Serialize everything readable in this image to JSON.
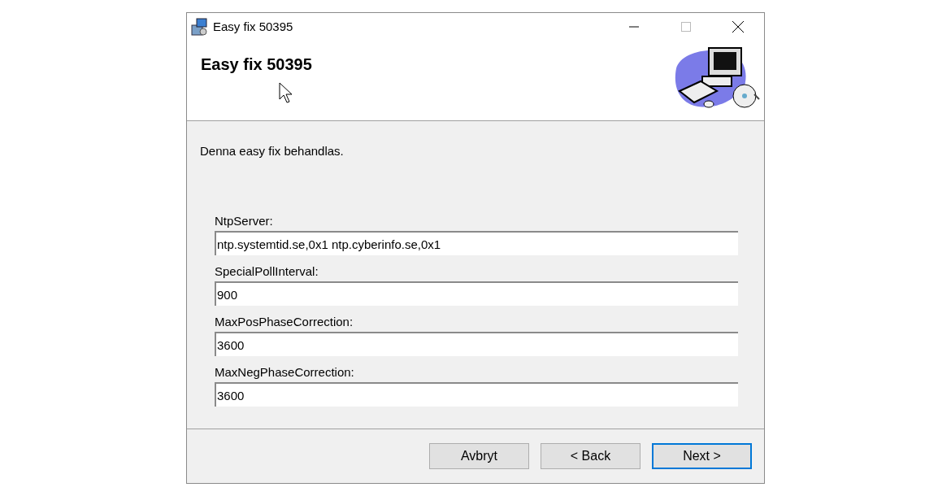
{
  "window": {
    "title": "Easy fix 50395"
  },
  "header": {
    "title": "Easy fix 50395"
  },
  "message": "Denna easy fix behandlas.",
  "fields": [
    {
      "label": "NtpServer:",
      "value": "ntp.systemtid.se,0x1 ntp.cyberinfo.se,0x1"
    },
    {
      "label": "SpecialPollInterval:",
      "value": "900"
    },
    {
      "label": "MaxPosPhaseCorrection:",
      "value": "3600"
    },
    {
      "label": "MaxNegPhaseCorrection:",
      "value": "3600"
    }
  ],
  "buttons": [
    {
      "label": "Avbryt",
      "default": false
    },
    {
      "label": "< Back",
      "default": false
    },
    {
      "label": "Next >",
      "default": true
    }
  ]
}
